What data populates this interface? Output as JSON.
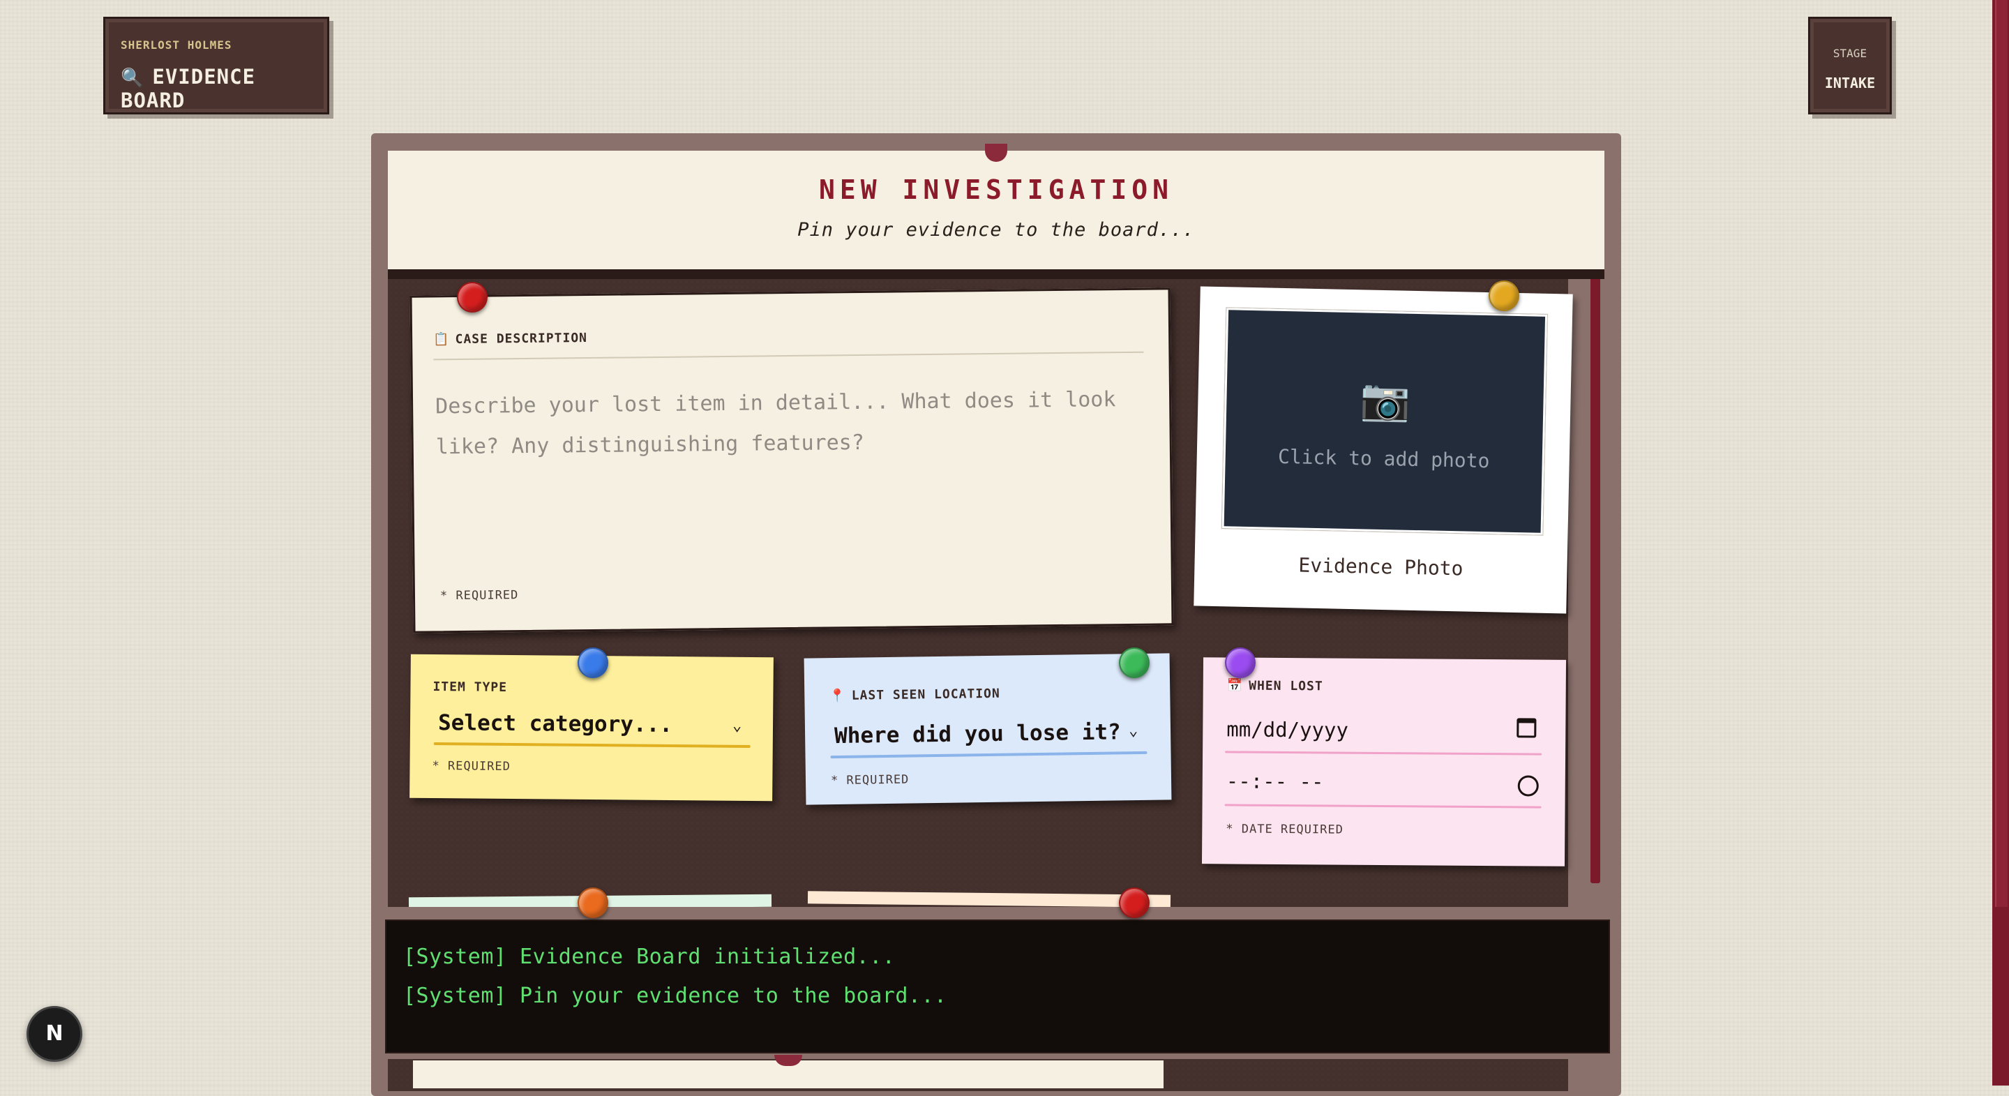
{
  "brand": {
    "kicker": "SHERLOST HOLMES",
    "title": "EVIDENCE BOARD",
    "icon": "magnifier-icon"
  },
  "stage": {
    "label": "STAGE",
    "value": "INTAKE"
  },
  "header": {
    "title": "NEW INVESTIGATION",
    "subtitle": "Pin your evidence to the board..."
  },
  "case_description": {
    "label": "CASE DESCRIPTION",
    "icon": "notepad-icon",
    "placeholder": "Describe your lost item in detail... What does it look like? Any distinguishing features?",
    "required": "* REQUIRED"
  },
  "photo": {
    "prompt": "Click to add photo",
    "caption": "Evidence Photo",
    "icon": "camera-icon"
  },
  "item_type": {
    "label": "ITEM TYPE",
    "value": "Select category...",
    "required": "* REQUIRED"
  },
  "location": {
    "label": "LAST SEEN LOCATION",
    "icon": "pin-icon",
    "value": "Where did you lose it?",
    "required": "* REQUIRED"
  },
  "when_lost": {
    "label": "WHEN LOST",
    "icon": "calendar-icon",
    "date_placeholder": "mm/dd/yyyy",
    "time_placeholder": "--:-- --",
    "required": "* DATE REQUIRED"
  },
  "console": {
    "lines": [
      "[System] Evidence Board initialized...",
      "[System] Pin your evidence to the board..."
    ]
  },
  "fab": {
    "label": "N"
  },
  "colors": {
    "accent": "#8b1a2a",
    "cork": "#44302c",
    "console_text": "#5fe070"
  }
}
